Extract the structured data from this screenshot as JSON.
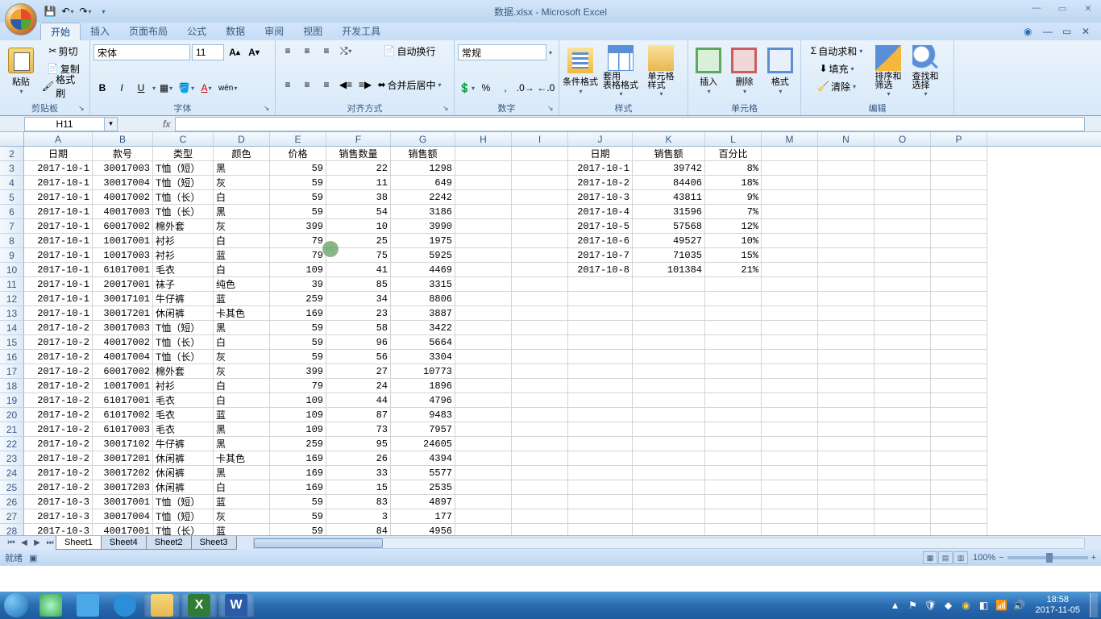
{
  "title": "数据.xlsx - Microsoft Excel",
  "tabs": [
    "开始",
    "插入",
    "页面布局",
    "公式",
    "数据",
    "审阅",
    "视图",
    "开发工具"
  ],
  "active_tab": 0,
  "clipboard": {
    "paste": "粘贴",
    "cut": "剪切",
    "copy": "复制",
    "format_painter": "格式刷",
    "group": "剪贴板"
  },
  "font": {
    "name": "宋体",
    "size": "11",
    "group": "字体",
    "bold": "B",
    "italic": "I",
    "underline": "U"
  },
  "align": {
    "wrap": "自动换行",
    "merge": "合并后居中",
    "group": "对齐方式"
  },
  "number": {
    "format": "常规",
    "group": "数字"
  },
  "styles": {
    "cond": "条件格式",
    "table": "套用\n表格格式",
    "cell": "单元格\n样式",
    "group": "样式"
  },
  "cells": {
    "insert": "插入",
    "delete": "删除",
    "format": "格式",
    "group": "单元格"
  },
  "editing": {
    "autosum": "自动求和",
    "fill": "填充",
    "clear": "清除",
    "sort": "排序和\n筛选",
    "find": "查找和\n选择",
    "group": "编辑"
  },
  "namebox": "H11",
  "columns": [
    "A",
    "B",
    "C",
    "D",
    "E",
    "F",
    "G",
    "H",
    "I",
    "J",
    "K",
    "L",
    "M",
    "N",
    "O",
    "P"
  ],
  "row_start": 2,
  "headers_main": [
    "日期",
    "款号",
    "类型",
    "颜色",
    "价格",
    "销售数量",
    "销售额"
  ],
  "headers_right": [
    "日期",
    "销售额",
    "百分比"
  ],
  "data_main": [
    [
      "2017-10-1",
      "30017003",
      "T恤（短）",
      "黑",
      "59",
      "22",
      "1298"
    ],
    [
      "2017-10-1",
      "30017004",
      "T恤（短）",
      "灰",
      "59",
      "11",
      "649"
    ],
    [
      "2017-10-1",
      "40017002",
      "T恤（长）",
      "白",
      "59",
      "38",
      "2242"
    ],
    [
      "2017-10-1",
      "40017003",
      "T恤（长）",
      "黑",
      "59",
      "54",
      "3186"
    ],
    [
      "2017-10-1",
      "60017002",
      "棉外套",
      "灰",
      "399",
      "10",
      "3990"
    ],
    [
      "2017-10-1",
      "10017001",
      "衬衫",
      "白",
      "79",
      "25",
      "1975"
    ],
    [
      "2017-10-1",
      "10017003",
      "衬衫",
      "蓝",
      "79",
      "75",
      "5925"
    ],
    [
      "2017-10-1",
      "61017001",
      "毛衣",
      "白",
      "109",
      "41",
      "4469"
    ],
    [
      "2017-10-1",
      "20017001",
      "袜子",
      "纯色",
      "39",
      "85",
      "3315"
    ],
    [
      "2017-10-1",
      "30017101",
      "牛仔裤",
      "蓝",
      "259",
      "34",
      "8806"
    ],
    [
      "2017-10-1",
      "30017201",
      "休闲裤",
      "卡其色",
      "169",
      "23",
      "3887"
    ],
    [
      "2017-10-2",
      "30017003",
      "T恤（短）",
      "黑",
      "59",
      "58",
      "3422"
    ],
    [
      "2017-10-2",
      "40017002",
      "T恤（长）",
      "白",
      "59",
      "96",
      "5664"
    ],
    [
      "2017-10-2",
      "40017004",
      "T恤（长）",
      "灰",
      "59",
      "56",
      "3304"
    ],
    [
      "2017-10-2",
      "60017002",
      "棉外套",
      "灰",
      "399",
      "27",
      "10773"
    ],
    [
      "2017-10-2",
      "10017001",
      "衬衫",
      "白",
      "79",
      "24",
      "1896"
    ],
    [
      "2017-10-2",
      "61017001",
      "毛衣",
      "白",
      "109",
      "44",
      "4796"
    ],
    [
      "2017-10-2",
      "61017002",
      "毛衣",
      "蓝",
      "109",
      "87",
      "9483"
    ],
    [
      "2017-10-2",
      "61017003",
      "毛衣",
      "黑",
      "109",
      "73",
      "7957"
    ],
    [
      "2017-10-2",
      "30017102",
      "牛仔裤",
      "黑",
      "259",
      "95",
      "24605"
    ],
    [
      "2017-10-2",
      "30017201",
      "休闲裤",
      "卡其色",
      "169",
      "26",
      "4394"
    ],
    [
      "2017-10-2",
      "30017202",
      "休闲裤",
      "黑",
      "169",
      "33",
      "5577"
    ],
    [
      "2017-10-2",
      "30017203",
      "休闲裤",
      "白",
      "169",
      "15",
      "2535"
    ],
    [
      "2017-10-3",
      "30017001",
      "T恤（短）",
      "蓝",
      "59",
      "83",
      "4897"
    ],
    [
      "2017-10-3",
      "30017004",
      "T恤（短）",
      "灰",
      "59",
      "3",
      "177"
    ],
    [
      "2017-10-3",
      "40017001",
      "T恤（长）",
      "蓝",
      "59",
      "84",
      "4956"
    ]
  ],
  "data_right": [
    [
      "2017-10-1",
      "39742",
      "8%"
    ],
    [
      "2017-10-2",
      "84406",
      "18%"
    ],
    [
      "2017-10-3",
      "43811",
      "9%"
    ],
    [
      "2017-10-4",
      "31596",
      "7%"
    ],
    [
      "2017-10-5",
      "57568",
      "12%"
    ],
    [
      "2017-10-6",
      "49527",
      "10%"
    ],
    [
      "2017-10-7",
      "71035",
      "15%"
    ],
    [
      "2017-10-8",
      "101384",
      "21%"
    ]
  ],
  "sheets": [
    "Sheet1",
    "Sheet4",
    "Sheet2",
    "Sheet3"
  ],
  "status": {
    "ready": "就绪",
    "zoom": "100%"
  },
  "taskbar": {
    "time": "18:58",
    "date": "2017-11-05"
  }
}
